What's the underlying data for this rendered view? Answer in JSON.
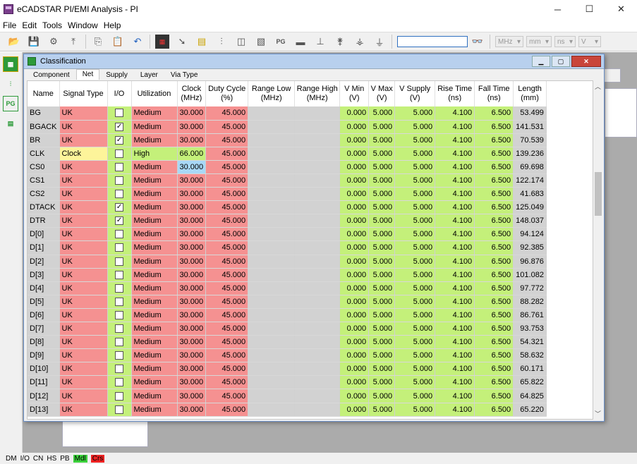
{
  "app": {
    "title": "eCADSTAR PI/EMI Analysis - PI",
    "win_min": "─",
    "win_max": "☐",
    "win_close": "✕"
  },
  "menu": [
    "File",
    "Edit",
    "Tools",
    "Window",
    "Help"
  ],
  "toolbar": {
    "units": [
      "MHz",
      "mm",
      "ns",
      "V"
    ],
    "search_value": ""
  },
  "leftbar": [
    "grid-icon",
    "chart-icon",
    "PG",
    "board-icon"
  ],
  "statusbar": [
    "DM",
    "I/O",
    "CN",
    "HS",
    "PB",
    "Mdl",
    "Crs"
  ],
  "dialog": {
    "title": "Classification",
    "tabs": [
      "Component",
      "Net",
      "Supply",
      "Layer",
      "Via Type"
    ],
    "active_tab": "Net"
  },
  "columns": [
    {
      "l1": "",
      "l2": "Name"
    },
    {
      "l1": "",
      "l2": "Signal Type"
    },
    {
      "l1": "",
      "l2": "I/O"
    },
    {
      "l1": "",
      "l2": "Utilization"
    },
    {
      "l1": "Clock",
      "l2": "(MHz)"
    },
    {
      "l1": "Duty Cycle",
      "l2": "(%)"
    },
    {
      "l1": "Range Low",
      "l2": "(MHz)"
    },
    {
      "l1": "Range High",
      "l2": "(MHz)"
    },
    {
      "l1": "V Min",
      "l2": "(V)"
    },
    {
      "l1": "V Max",
      "l2": "(V)"
    },
    {
      "l1": "V Supply",
      "l2": "(V)"
    },
    {
      "l1": "Rise Time",
      "l2": "(ns)"
    },
    {
      "l1": "Fall Time",
      "l2": "(ns)"
    },
    {
      "l1": "Length",
      "l2": "(mm)"
    }
  ],
  "rows": [
    {
      "name": "BG",
      "sig": "UK",
      "io": false,
      "util": "Medium",
      "clock": "30.000",
      "duty": "45.000",
      "vmin": "0.000",
      "vmax": "5.000",
      "vsup": "5.000",
      "rise": "4.100",
      "fall": "6.500",
      "len": "53.499"
    },
    {
      "name": "BGACK",
      "sig": "UK",
      "io": true,
      "util": "Medium",
      "clock": "30.000",
      "duty": "45.000",
      "vmin": "0.000",
      "vmax": "5.000",
      "vsup": "5.000",
      "rise": "4.100",
      "fall": "6.500",
      "len": "141.531"
    },
    {
      "name": "BR",
      "sig": "UK",
      "io": true,
      "util": "Medium",
      "clock": "30.000",
      "duty": "45.000",
      "vmin": "0.000",
      "vmax": "5.000",
      "vsup": "5.000",
      "rise": "4.100",
      "fall": "6.500",
      "len": "70.539"
    },
    {
      "name": "CLK",
      "sig": "Clock",
      "io": false,
      "util": "High",
      "clock": "66.000",
      "duty": "45.000",
      "vmin": "0.000",
      "vmax": "5.000",
      "vsup": "5.000",
      "rise": "4.100",
      "fall": "6.500",
      "len": "139.236"
    },
    {
      "name": "CS0",
      "sig": "UK",
      "io": false,
      "util": "Medium",
      "clock": "30.000",
      "duty": "45.000",
      "vmin": "0.000",
      "vmax": "5.000",
      "vsup": "5.000",
      "rise": "4.100",
      "fall": "6.500",
      "len": "69.698",
      "selected": true
    },
    {
      "name": "CS1",
      "sig": "UK",
      "io": false,
      "util": "Medium",
      "clock": "30.000",
      "duty": "45.000",
      "vmin": "0.000",
      "vmax": "5.000",
      "vsup": "5.000",
      "rise": "4.100",
      "fall": "6.500",
      "len": "122.174"
    },
    {
      "name": "CS2",
      "sig": "UK",
      "io": false,
      "util": "Medium",
      "clock": "30.000",
      "duty": "45.000",
      "vmin": "0.000",
      "vmax": "5.000",
      "vsup": "5.000",
      "rise": "4.100",
      "fall": "6.500",
      "len": "41.683"
    },
    {
      "name": "DTACK",
      "sig": "UK",
      "io": true,
      "util": "Medium",
      "clock": "30.000",
      "duty": "45.000",
      "vmin": "0.000",
      "vmax": "5.000",
      "vsup": "5.000",
      "rise": "4.100",
      "fall": "6.500",
      "len": "125.049"
    },
    {
      "name": "DTR",
      "sig": "UK",
      "io": true,
      "util": "Medium",
      "clock": "30.000",
      "duty": "45.000",
      "vmin": "0.000",
      "vmax": "5.000",
      "vsup": "5.000",
      "rise": "4.100",
      "fall": "6.500",
      "len": "148.037"
    },
    {
      "name": "D[0]",
      "sig": "UK",
      "io": false,
      "util": "Medium",
      "clock": "30.000",
      "duty": "45.000",
      "vmin": "0.000",
      "vmax": "5.000",
      "vsup": "5.000",
      "rise": "4.100",
      "fall": "6.500",
      "len": "94.124"
    },
    {
      "name": "D[1]",
      "sig": "UK",
      "io": false,
      "util": "Medium",
      "clock": "30.000",
      "duty": "45.000",
      "vmin": "0.000",
      "vmax": "5.000",
      "vsup": "5.000",
      "rise": "4.100",
      "fall": "6.500",
      "len": "92.385"
    },
    {
      "name": "D[2]",
      "sig": "UK",
      "io": false,
      "util": "Medium",
      "clock": "30.000",
      "duty": "45.000",
      "vmin": "0.000",
      "vmax": "5.000",
      "vsup": "5.000",
      "rise": "4.100",
      "fall": "6.500",
      "len": "96.876"
    },
    {
      "name": "D[3]",
      "sig": "UK",
      "io": false,
      "util": "Medium",
      "clock": "30.000",
      "duty": "45.000",
      "vmin": "0.000",
      "vmax": "5.000",
      "vsup": "5.000",
      "rise": "4.100",
      "fall": "6.500",
      "len": "101.082"
    },
    {
      "name": "D[4]",
      "sig": "UK",
      "io": false,
      "util": "Medium",
      "clock": "30.000",
      "duty": "45.000",
      "vmin": "0.000",
      "vmax": "5.000",
      "vsup": "5.000",
      "rise": "4.100",
      "fall": "6.500",
      "len": "97.772"
    },
    {
      "name": "D[5]",
      "sig": "UK",
      "io": false,
      "util": "Medium",
      "clock": "30.000",
      "duty": "45.000",
      "vmin": "0.000",
      "vmax": "5.000",
      "vsup": "5.000",
      "rise": "4.100",
      "fall": "6.500",
      "len": "88.282"
    },
    {
      "name": "D[6]",
      "sig": "UK",
      "io": false,
      "util": "Medium",
      "clock": "30.000",
      "duty": "45.000",
      "vmin": "0.000",
      "vmax": "5.000",
      "vsup": "5.000",
      "rise": "4.100",
      "fall": "6.500",
      "len": "86.761"
    },
    {
      "name": "D[7]",
      "sig": "UK",
      "io": false,
      "util": "Medium",
      "clock": "30.000",
      "duty": "45.000",
      "vmin": "0.000",
      "vmax": "5.000",
      "vsup": "5.000",
      "rise": "4.100",
      "fall": "6.500",
      "len": "93.753"
    },
    {
      "name": "D[8]",
      "sig": "UK",
      "io": false,
      "util": "Medium",
      "clock": "30.000",
      "duty": "45.000",
      "vmin": "0.000",
      "vmax": "5.000",
      "vsup": "5.000",
      "rise": "4.100",
      "fall": "6.500",
      "len": "54.321"
    },
    {
      "name": "D[9]",
      "sig": "UK",
      "io": false,
      "util": "Medium",
      "clock": "30.000",
      "duty": "45.000",
      "vmin": "0.000",
      "vmax": "5.000",
      "vsup": "5.000",
      "rise": "4.100",
      "fall": "6.500",
      "len": "58.632"
    },
    {
      "name": "D[10]",
      "sig": "UK",
      "io": false,
      "util": "Medium",
      "clock": "30.000",
      "duty": "45.000",
      "vmin": "0.000",
      "vmax": "5.000",
      "vsup": "5.000",
      "rise": "4.100",
      "fall": "6.500",
      "len": "60.171"
    },
    {
      "name": "D[11]",
      "sig": "UK",
      "io": false,
      "util": "Medium",
      "clock": "30.000",
      "duty": "45.000",
      "vmin": "0.000",
      "vmax": "5.000",
      "vsup": "5.000",
      "rise": "4.100",
      "fall": "6.500",
      "len": "65.822"
    },
    {
      "name": "D[12]",
      "sig": "UK",
      "io": false,
      "util": "Medium",
      "clock": "30.000",
      "duty": "45.000",
      "vmin": "0.000",
      "vmax": "5.000",
      "vsup": "5.000",
      "rise": "4.100",
      "fall": "6.500",
      "len": "64.825"
    },
    {
      "name": "D[13]",
      "sig": "UK",
      "io": false,
      "util": "Medium",
      "clock": "30.000",
      "duty": "45.000",
      "vmin": "0.000",
      "vmax": "5.000",
      "vsup": "5.000",
      "rise": "4.100",
      "fall": "6.500",
      "len": "65.220"
    }
  ]
}
